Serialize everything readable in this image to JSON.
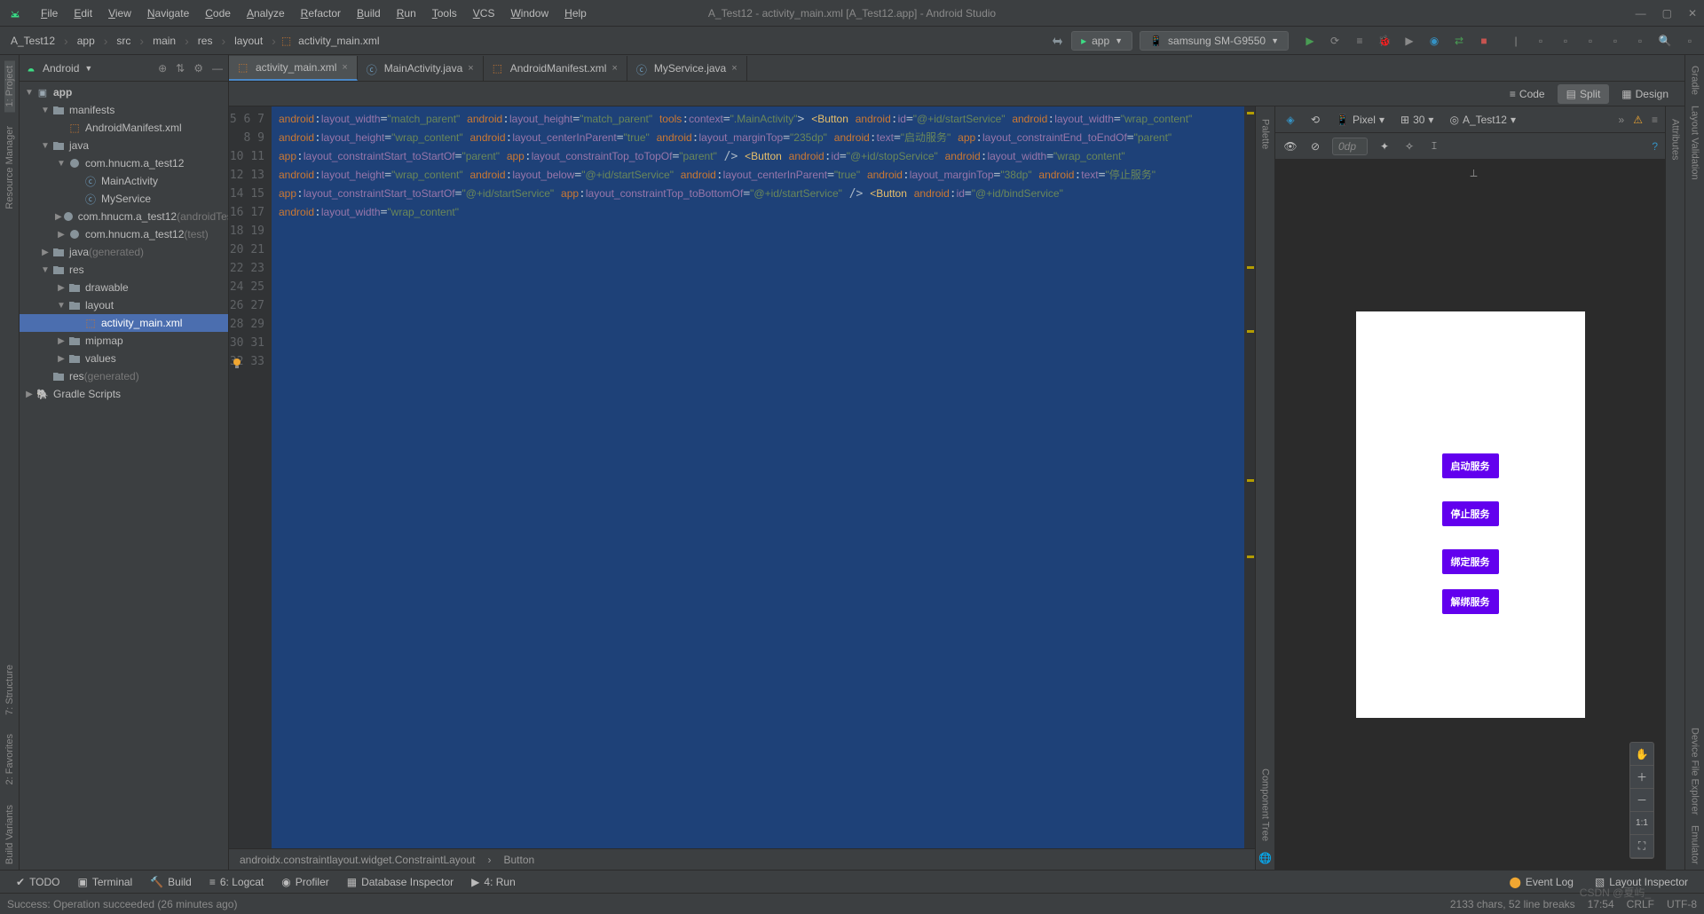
{
  "window_title": "A_Test12 - activity_main.xml [A_Test12.app] - Android Studio",
  "menu": [
    "File",
    "Edit",
    "View",
    "Navigate",
    "Code",
    "Analyze",
    "Refactor",
    "Build",
    "Run",
    "Tools",
    "VCS",
    "Window",
    "Help"
  ],
  "breadcrumb": [
    "A_Test12",
    "app",
    "src",
    "main",
    "res",
    "layout",
    "activity_main.xml"
  ],
  "run_config": {
    "app": "app",
    "device": "samsung SM-G9550"
  },
  "project_view": "Android",
  "tree": {
    "root": "app",
    "items": [
      {
        "l": 1,
        "exp": true,
        "ico": "folder",
        "label": "manifests"
      },
      {
        "l": 2,
        "ico": "xml",
        "label": "AndroidManifest.xml"
      },
      {
        "l": 1,
        "exp": true,
        "ico": "folder",
        "label": "java"
      },
      {
        "l": 2,
        "exp": true,
        "ico": "pkg",
        "label": "com.hnucm.a_test12"
      },
      {
        "l": 3,
        "ico": "java",
        "label": "MainActivity"
      },
      {
        "l": 3,
        "ico": "java",
        "label": "MyService"
      },
      {
        "l": 2,
        "exp": false,
        "ico": "pkg",
        "label": "com.hnucm.a_test12",
        "suffix": "(androidTest)"
      },
      {
        "l": 2,
        "exp": false,
        "ico": "pkg",
        "label": "com.hnucm.a_test12",
        "suffix": "(test)"
      },
      {
        "l": 1,
        "exp": false,
        "ico": "folder",
        "label": "java",
        "suffix": "(generated)"
      },
      {
        "l": 1,
        "exp": true,
        "ico": "folder",
        "label": "res"
      },
      {
        "l": 2,
        "exp": false,
        "ico": "folder",
        "label": "drawable"
      },
      {
        "l": 2,
        "exp": true,
        "ico": "folder",
        "label": "layout"
      },
      {
        "l": 3,
        "ico": "xml",
        "label": "activity_main.xml",
        "sel": true
      },
      {
        "l": 2,
        "exp": false,
        "ico": "folder",
        "label": "mipmap"
      },
      {
        "l": 2,
        "exp": false,
        "ico": "folder",
        "label": "values"
      },
      {
        "l": 1,
        "ico": "folder",
        "label": "res",
        "suffix": "(generated)"
      }
    ],
    "gradle": "Gradle Scripts"
  },
  "tabs": [
    {
      "label": "activity_main.xml",
      "ico": "xml",
      "active": true
    },
    {
      "label": "MainActivity.java",
      "ico": "java"
    },
    {
      "label": "AndroidManifest.xml",
      "ico": "xml"
    },
    {
      "label": "MyService.java",
      "ico": "java"
    }
  ],
  "view_modes": {
    "code": "Code",
    "split": "Split",
    "design": "Design"
  },
  "gutter_start": 5,
  "gutter_end": 33,
  "code_lines": [
    [
      {
        "ns": "android"
      },
      {
        "p": ":"
      },
      {
        "attr": "layout_width"
      },
      {
        "p": "="
      },
      {
        "str": "\"match_parent\""
      }
    ],
    [
      {
        "ns": "android"
      },
      {
        "p": ":"
      },
      {
        "attr": "layout_height"
      },
      {
        "p": "="
      },
      {
        "str": "\"match_parent\""
      }
    ],
    [
      {
        "ns": "tools"
      },
      {
        "p": ":"
      },
      {
        "attr": "context"
      },
      {
        "p": "="
      },
      {
        "str": "\".MainActivity\""
      },
      {
        "p": ">"
      }
    ],
    [],
    [
      {
        "tag": "<Button"
      }
    ],
    [
      {
        "pad": 1
      },
      {
        "ns": "android"
      },
      {
        "p": ":"
      },
      {
        "attr": "id"
      },
      {
        "p": "="
      },
      {
        "str": "\"@+id/startService\""
      }
    ],
    [
      {
        "pad": 1
      },
      {
        "ns": "android"
      },
      {
        "p": ":"
      },
      {
        "attr": "layout_width"
      },
      {
        "p": "="
      },
      {
        "str": "\"wrap_content\""
      }
    ],
    [
      {
        "pad": 1
      },
      {
        "ns": "android"
      },
      {
        "p": ":"
      },
      {
        "attr": "layout_height"
      },
      {
        "p": "="
      },
      {
        "str": "\"wrap_content\""
      }
    ],
    [
      {
        "pad": 1
      },
      {
        "ns": "android"
      },
      {
        "p": ":"
      },
      {
        "attr": "layout_centerInParent"
      },
      {
        "p": "="
      },
      {
        "str": "\"true\""
      }
    ],
    [
      {
        "pad": 1
      },
      {
        "ns": "android"
      },
      {
        "p": ":"
      },
      {
        "attr": "layout_marginTop"
      },
      {
        "p": "="
      },
      {
        "str": "\"235dp\""
      }
    ],
    [
      {
        "pad": 1
      },
      {
        "ns": "android"
      },
      {
        "p": ":"
      },
      {
        "attr": "text"
      },
      {
        "p": "="
      },
      {
        "str": "\"启动服务\""
      }
    ],
    [
      {
        "pad": 1
      },
      {
        "ns": "app"
      },
      {
        "p": ":"
      },
      {
        "attr": "layout_constraintEnd_toEndOf"
      },
      {
        "p": "="
      },
      {
        "str": "\"parent\""
      }
    ],
    [
      {
        "pad": 1
      },
      {
        "ns": "app"
      },
      {
        "p": ":"
      },
      {
        "attr": "layout_constraintStart_toStartOf"
      },
      {
        "p": "="
      },
      {
        "str": "\"parent\""
      }
    ],
    [
      {
        "pad": 1
      },
      {
        "ns": "app"
      },
      {
        "p": ":"
      },
      {
        "attr": "layout_constraintTop_toTopOf"
      },
      {
        "p": "="
      },
      {
        "str": "\"parent\""
      },
      {
        "p": " />"
      }
    ],
    [],
    [
      {
        "tag": "<Button"
      }
    ],
    [
      {
        "pad": 1
      },
      {
        "ns": "android"
      },
      {
        "p": ":"
      },
      {
        "attr": "id"
      },
      {
        "p": "="
      },
      {
        "str": "\"@+id/stopService\""
      }
    ],
    [
      {
        "pad": 1
      },
      {
        "ns": "android"
      },
      {
        "p": ":"
      },
      {
        "attr": "layout_width"
      },
      {
        "p": "="
      },
      {
        "str": "\"wrap_content\""
      }
    ],
    [
      {
        "pad": 1
      },
      {
        "ns": "android"
      },
      {
        "p": ":"
      },
      {
        "attr": "layout_height"
      },
      {
        "p": "="
      },
      {
        "str": "\"wrap_content\""
      }
    ],
    [
      {
        "pad": 1
      },
      {
        "ns": "android"
      },
      {
        "p": ":"
      },
      {
        "attr": "layout_below"
      },
      {
        "p": "="
      },
      {
        "str": "\"@+id/startService\""
      }
    ],
    [
      {
        "pad": 1
      },
      {
        "ns": "android"
      },
      {
        "p": ":"
      },
      {
        "attr": "layout_centerInParent"
      },
      {
        "p": "="
      },
      {
        "str": "\"true\""
      }
    ],
    [
      {
        "pad": 1
      },
      {
        "ns": "android"
      },
      {
        "p": ":"
      },
      {
        "attr": "layout_marginTop"
      },
      {
        "p": "="
      },
      {
        "str": "\"38dp\""
      }
    ],
    [
      {
        "pad": 1
      },
      {
        "ns": "android"
      },
      {
        "p": ":"
      },
      {
        "attr": "text"
      },
      {
        "p": "="
      },
      {
        "str": "\"停止服务\""
      }
    ],
    [
      {
        "pad": 1
      },
      {
        "ns": "app"
      },
      {
        "p": ":"
      },
      {
        "attr": "layout_constraintStart_toStartOf"
      },
      {
        "p": "="
      },
      {
        "str": "\"@+id/startService\""
      }
    ],
    [
      {
        "pad": 1
      },
      {
        "ns": "app"
      },
      {
        "p": ":"
      },
      {
        "attr": "layout_constraintTop_toBottomOf"
      },
      {
        "p": "="
      },
      {
        "str": "\"@+id/startService\""
      },
      {
        "p": " />"
      }
    ],
    [],
    [
      {
        "tag": "<Button"
      }
    ],
    [
      {
        "pad": 1
      },
      {
        "ns": "android"
      },
      {
        "p": ":"
      },
      {
        "attr": "id"
      },
      {
        "p": "="
      },
      {
        "str": "\"@+id/bindService\""
      }
    ],
    [
      {
        "pad": 1
      },
      {
        "ns": "android"
      },
      {
        "p": ":"
      },
      {
        "attr": "layout_width"
      },
      {
        "p": "="
      },
      {
        "str": "\"wrap_content\""
      }
    ]
  ],
  "bc_bottom": [
    "androidx.constraintlayout.widget.ConstraintLayout",
    "Button"
  ],
  "design": {
    "device": "Pixel",
    "api": "30",
    "module": "A_Test12",
    "dp": "0dp",
    "buttons": [
      "启动服务",
      "停止服务",
      "绑定服务",
      "解绑服务"
    ],
    "zoom": "1:1"
  },
  "left_tools": [
    "1: Project",
    "Resource Manager"
  ],
  "left_tools_bottom": [
    "2: Favorites",
    "7: Structure",
    "Build Variants"
  ],
  "right_tools_top": [
    "Gradle",
    "Layout Validation"
  ],
  "right_tools_bottom": [
    "Device File Explorer",
    "Emulator"
  ],
  "palette_labels": [
    "Palette",
    "Component Tree"
  ],
  "attributes_label": "Attributes",
  "bottom_tools": {
    "left": [
      "TODO",
      "Terminal",
      "Build",
      "6: Logcat",
      "Profiler",
      "Database Inspector",
      "4: Run"
    ],
    "right": [
      "Event Log",
      "Layout Inspector"
    ]
  },
  "status": {
    "msg": "Success: Operation succeeded (26 minutes ago)",
    "chars": "2133 chars, 52 line breaks",
    "pos": "17:54",
    "crlf": "CRLF",
    "enc": "UTF-8"
  },
  "watermark": "CSDN @夏屿_"
}
